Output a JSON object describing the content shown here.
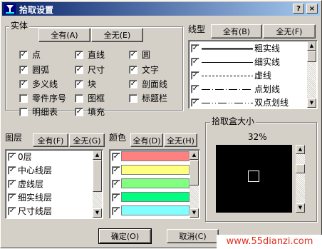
{
  "window": {
    "title": "拾取设置",
    "help_button": "?",
    "close_button": "×"
  },
  "entity": {
    "group_title": "实体",
    "all_button": "全有(A)",
    "none_button": "全无(E)",
    "items": [
      {
        "label": "点",
        "checked": true
      },
      {
        "label": "直线",
        "checked": true
      },
      {
        "label": "圆",
        "checked": true
      },
      {
        "label": "圆弧",
        "checked": true
      },
      {
        "label": "尺寸",
        "checked": true
      },
      {
        "label": "文字",
        "checked": true
      },
      {
        "label": "多义线",
        "checked": true
      },
      {
        "label": "块",
        "checked": true
      },
      {
        "label": "剖面线",
        "checked": true
      },
      {
        "label": "零件序号",
        "checked": false
      },
      {
        "label": "图框",
        "checked": false
      },
      {
        "label": "标题栏",
        "checked": false
      },
      {
        "label": "明细表",
        "checked": false
      },
      {
        "label": "填充",
        "checked": true
      }
    ]
  },
  "linetype": {
    "label": "线型",
    "all_button": "全有(B)",
    "none_button": "全无(F)",
    "items": [
      {
        "label": "粗实线",
        "style": "thick",
        "checked": true
      },
      {
        "label": "细实线",
        "style": "thin",
        "checked": true
      },
      {
        "label": "虚线",
        "style": "dashed",
        "checked": true
      },
      {
        "label": "点划线",
        "style": "dashdot",
        "checked": true
      },
      {
        "label": "双点划线",
        "style": "dashdotdot",
        "checked": true
      }
    ]
  },
  "layer": {
    "label": "图层",
    "all_button": "全有(F)",
    "none_button": "全无(G)",
    "items": [
      {
        "label": "0层",
        "checked": true
      },
      {
        "label": "中心线层",
        "checked": true
      },
      {
        "label": "虚线层",
        "checked": true
      },
      {
        "label": "细实线层",
        "checked": true
      },
      {
        "label": "尺寸线层",
        "checked": true
      }
    ]
  },
  "color": {
    "label": "颜色",
    "all_button": "全有(D)",
    "none_button": "全无(H)",
    "items": [
      {
        "color": "#ff8080",
        "checked": true
      },
      {
        "color": "#ffff80",
        "checked": true
      },
      {
        "color": "#80ff80",
        "checked": true
      },
      {
        "color": "#00ff80",
        "checked": true
      },
      {
        "color": "#80ffff",
        "checked": true
      }
    ]
  },
  "pickbox": {
    "group_title": "拾取盒大小",
    "percent_text": "32%",
    "percent_value": 32
  },
  "footer": {
    "ok_button": "确定(O)",
    "cancel_button": "取消(C)"
  },
  "watermark": "www.55dianzi.com",
  "theme": {
    "face": "#d4d0c8",
    "title_start": "#0a246a",
    "title_end": "#a6caf0",
    "watermark_color": "#e0301e"
  },
  "icons": {
    "title": "cad-app-icon",
    "check": "check-mark-icon",
    "scroll_up": "scroll-up-arrow-icon",
    "scroll_down": "scroll-down-arrow-icon"
  }
}
